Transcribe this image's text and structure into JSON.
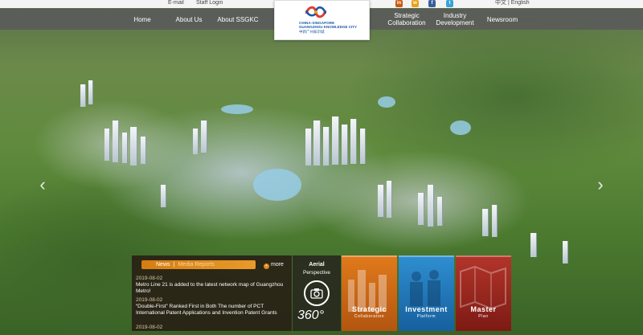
{
  "topbar": {
    "email": "E-mail",
    "staff_login": "Staff Login",
    "language": "中文 | English",
    "social": [
      {
        "icon": "linkedin-icon",
        "glyph": "in",
        "color": "#c95a12"
      },
      {
        "icon": "weibo-icon",
        "glyph": "w",
        "color": "#e8a21a"
      },
      {
        "icon": "facebook-icon",
        "glyph": "f",
        "color": "#3a5e9c"
      },
      {
        "icon": "twitter-icon",
        "glyph": "t",
        "color": "#37a3d9"
      }
    ]
  },
  "nav": {
    "home": "Home",
    "about_us": "About Us",
    "about_ssgkc": "About SSGKC",
    "strategic_1": "Strategic",
    "strategic_2": "Collaboration",
    "industry_1": "Industry",
    "industry_2": "Development",
    "newsroom": "Newsroom"
  },
  "logo": {
    "line1": "CHINA-SINGAPORE",
    "line2": "GUANGZHOU KNOWLEDGE CITY",
    "line3": "中新广州知识城"
  },
  "news": {
    "tab_news": "News",
    "separator": "|",
    "tab_media": "Media Reports",
    "more": "more",
    "items": [
      {
        "date": "2019-08-02",
        "title": "Metro Line 21 is added to the latest network map of Guangzhou Metro!"
      },
      {
        "date": "2019-08-02",
        "title": "“Double-First”  Ranked First in Both The number of PCT International Patent Applications and Invention Patent Grants"
      },
      {
        "date": "2019-08-02",
        "title": ""
      }
    ]
  },
  "tiles": {
    "aerial_1": "Aerial",
    "aerial_2": "Perspective",
    "aerial_3": "360°",
    "strategic_main": "Strategic",
    "strategic_sub": "Collaboration",
    "investment_main": "Investment",
    "investment_sub": "Platform",
    "master_main": "Master",
    "master_sub": "Plan"
  },
  "arrows": {
    "prev": "‹",
    "next": "›"
  },
  "colors": {
    "accent": "#e08a1a",
    "brand_blue": "#1b58a5"
  }
}
